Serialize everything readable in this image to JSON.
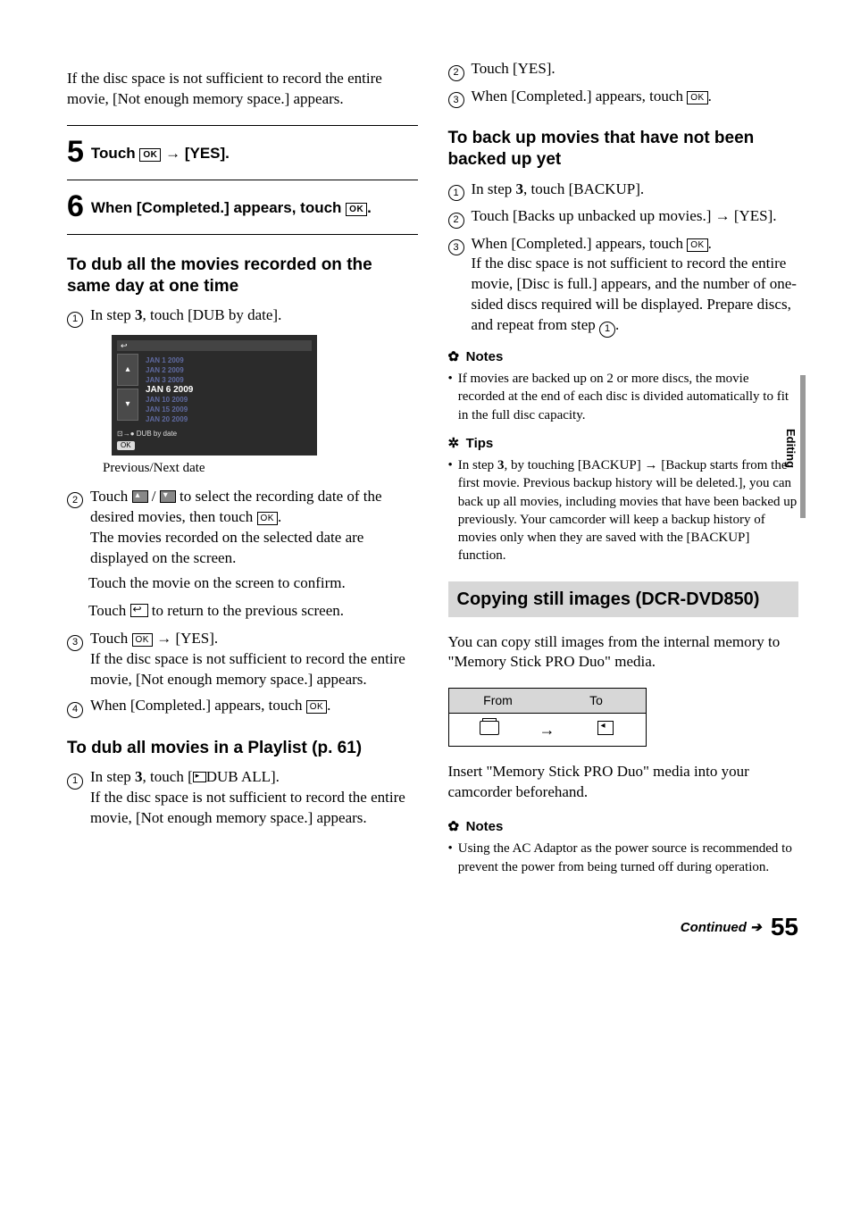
{
  "sideTab": "Editing",
  "left": {
    "intro": "If the disc space is not sufficient to record the entire movie, [Not enough memory space.] appears.",
    "step5_pre": "Touch ",
    "step5_post": " → [YES].",
    "step6_pre": "When [Completed.] appears, touch ",
    "step6_post": ".",
    "sub1_title": "To dub all the movies recorded on the same day at one time",
    "sub1_1_a": "In step ",
    "sub1_1_b": "3",
    "sub1_1_c": ", touch [DUB by date].",
    "screenshot": {
      "dates": [
        "JAN   1  2009",
        "JAN   2  2009",
        "JAN   3  2009",
        "JAN   6  2009",
        "JAN 10  2009",
        "JAN 15  2009",
        "JAN 20  2009"
      ],
      "selectedIndex": 3,
      "label": "DUB by date",
      "ok": "OK"
    },
    "caption": "Previous/Next date",
    "sub1_2_a": "Touch ",
    "sub1_2_b": " / ",
    "sub1_2_c": " to select the recording date of the desired movies, then touch ",
    "sub1_2_d": ".",
    "sub1_2_e": "The movies recorded on the selected date are displayed on the screen.",
    "sub1_confirm": "Touch the movie on the screen to confirm.",
    "sub1_return_a": "Touch ",
    "sub1_return_b": " to return to the previous screen.",
    "sub1_3_a": "Touch ",
    "sub1_3_b": " → [YES].",
    "sub1_3_c": "If the disc space is not sufficient to record the entire movie, [Not enough memory space.] appears.",
    "sub1_4_a": "When [Completed.] appears, touch ",
    "sub1_4_b": ".",
    "sub2_title": "To dub all movies in a Playlist (p. 61)",
    "sub2_1_a": "In step ",
    "sub2_1_b": "3",
    "sub2_1_c": ", touch [",
    "sub2_1_d": "DUB ALL].",
    "sub2_1_e": "If the disc space is not sufficient to record the entire movie, [Not enough memory space.] appears."
  },
  "right": {
    "r2": "Touch [YES].",
    "r3_a": "When [Completed.] appears, touch ",
    "r3_b": ".",
    "backup_title": "To back up movies that have not been backed up yet",
    "b1_a": "In step ",
    "b1_b": "3",
    "b1_c": ", touch [BACKUP].",
    "b2": "Touch [Backs up unbacked up movies.] → [YES].",
    "b3_a": "When [Completed.] appears, touch ",
    "b3_b": ".",
    "b3_c": "If the disc space is not sufficient to record the entire movie, [Disc is full.] appears, and the number of one-sided discs required will be displayed. Prepare discs, and repeat from step ",
    "b3_d": ".",
    "notes_label": "Notes",
    "note1": "If movies are backed up on 2 or more discs, the movie recorded at the end of each disc is divided automatically to fit in the full disc capacity.",
    "tips_label": "Tips",
    "tip1_a": "In step ",
    "tip1_b": "3",
    "tip1_c": ", by touching [BACKUP] → [Backup starts from the first movie. Previous backup history will be deleted.], you can back up all movies, including movies that have been backed up previously. Your camcorder will keep a backup history of movies only when they are saved with the [BACKUP] function.",
    "section_title": "Copying still images (DCR-DVD850)",
    "copy_intro": "You can copy still images from the internal memory to \"Memory Stick PRO Duo\" media.",
    "table": {
      "from": "From",
      "to": "To"
    },
    "copy_after": "Insert \"Memory Stick PRO Duo\" media into your camcorder beforehand.",
    "note2": "Using the AC Adaptor as the power source is recommended to prevent the power from being turned off during operation."
  },
  "footer": {
    "continued": "Continued",
    "arrow": "➔",
    "page": "55"
  },
  "ok_label": "OK"
}
